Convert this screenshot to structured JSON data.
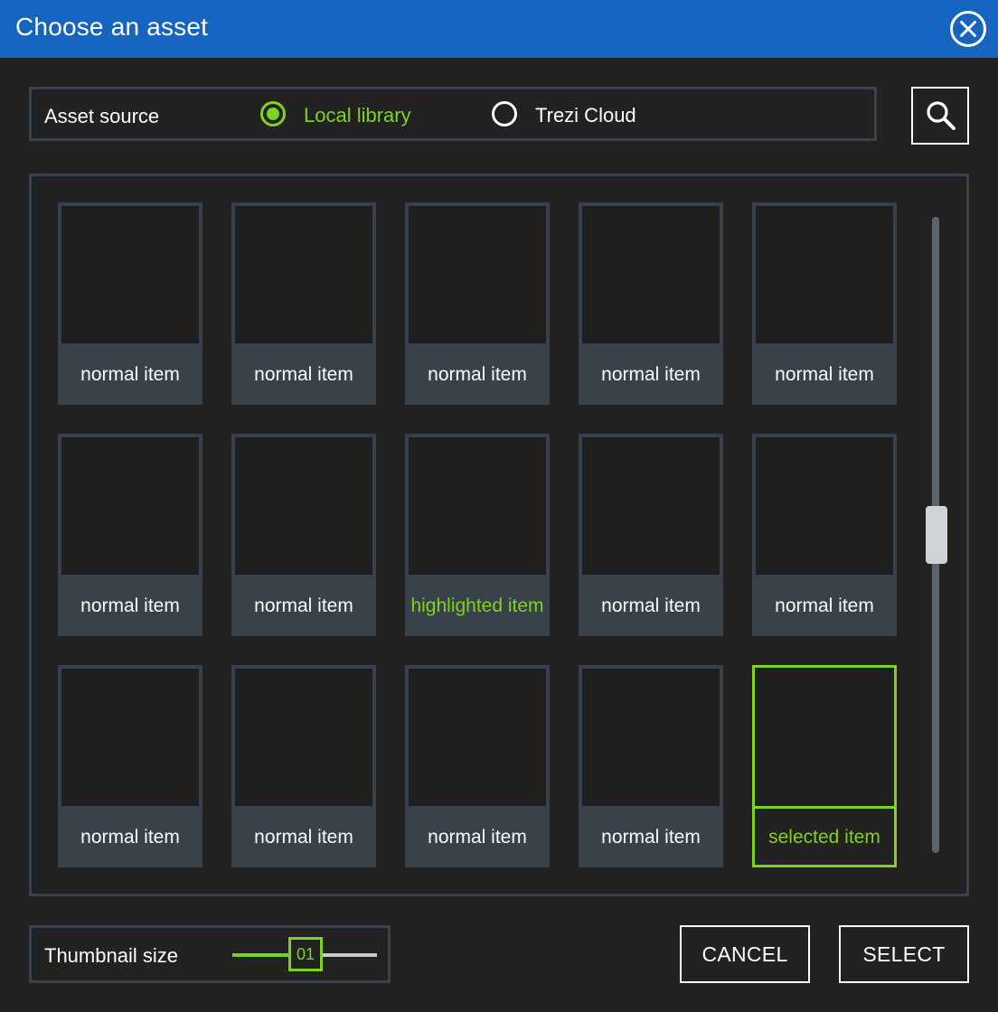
{
  "dialog": {
    "title": "Choose an asset",
    "close_icon": "close-circle-icon"
  },
  "asset_source": {
    "label": "Asset source",
    "options": [
      {
        "label": "Local library",
        "selected": true
      },
      {
        "label": "Trezi Cloud",
        "selected": false
      }
    ],
    "search_icon": "search-icon"
  },
  "grid": {
    "items": [
      {
        "label": "normal item",
        "state": "normal"
      },
      {
        "label": "normal item",
        "state": "normal"
      },
      {
        "label": "normal item",
        "state": "normal"
      },
      {
        "label": "normal item",
        "state": "normal"
      },
      {
        "label": "normal item",
        "state": "normal"
      },
      {
        "label": "normal item",
        "state": "normal"
      },
      {
        "label": "normal item",
        "state": "normal"
      },
      {
        "label": "highlighted item",
        "state": "highlighted"
      },
      {
        "label": "normal item",
        "state": "normal"
      },
      {
        "label": "normal item",
        "state": "normal"
      },
      {
        "label": "normal item",
        "state": "normal"
      },
      {
        "label": "normal item",
        "state": "normal"
      },
      {
        "label": "normal item",
        "state": "normal"
      },
      {
        "label": "normal item",
        "state": "normal"
      },
      {
        "label": "selected item",
        "state": "selected"
      }
    ]
  },
  "thumbnail_size": {
    "label": "Thumbnail size",
    "value": "01"
  },
  "footer": {
    "cancel_label": "CANCEL",
    "select_label": "SELECT"
  },
  "colors": {
    "titlebar": "#1565c0",
    "background": "#222222",
    "accent": "#7ed321",
    "panel_border": "#3a424c",
    "card": "#39414b"
  }
}
